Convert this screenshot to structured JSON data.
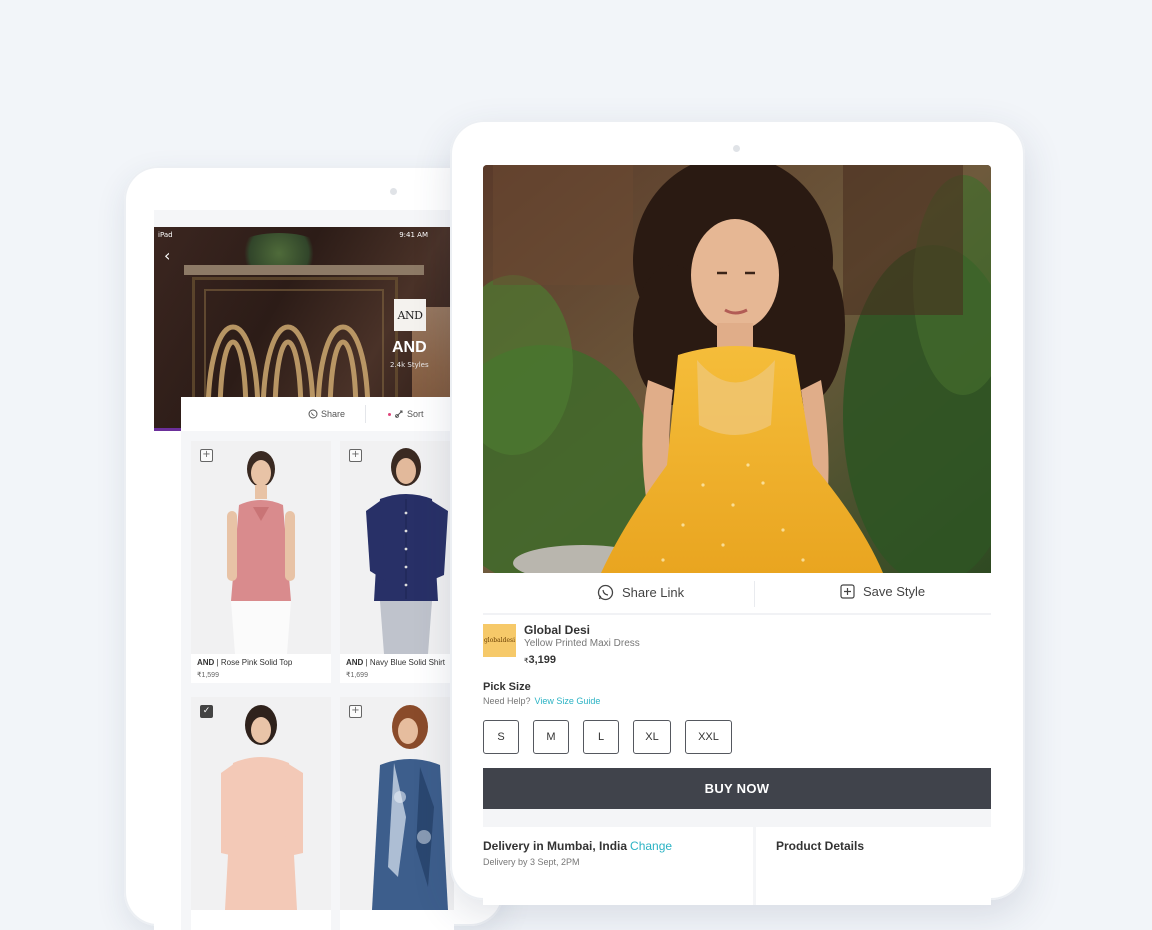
{
  "back_tablet": {
    "status_bar": {
      "device": "iPad",
      "time": "9:41 AM"
    },
    "brand": {
      "logo_text": "AND",
      "name": "AND",
      "styles_count": "2.4k Styles"
    },
    "toolbar": {
      "share_label": "Share",
      "sort_label": "Sort"
    },
    "products": [
      {
        "brand": "AND",
        "name": "Rose Pink Solid Top",
        "price": "₹1,599",
        "selected": false
      },
      {
        "brand": "AND",
        "name": "Navy Blue Solid Shirt",
        "price": "₹1,699",
        "selected": false
      },
      {
        "brand": "",
        "name": "",
        "price": "",
        "selected": true
      },
      {
        "brand": "",
        "name": "",
        "price": "",
        "selected": false
      }
    ]
  },
  "front_tablet": {
    "actions": {
      "share_label": "Share Link",
      "save_label": "Save Style"
    },
    "seller": {
      "logo_text": "globaldesi",
      "name": "Global Desi"
    },
    "product": {
      "name": "Yellow Printed Maxi Dress",
      "currency": "₹",
      "price": "3,199"
    },
    "size": {
      "heading": "Pick Size",
      "help_text": "Need Help?",
      "guide_link": "View Size Guide",
      "options": [
        "S",
        "M",
        "L",
        "XL",
        "XXL"
      ]
    },
    "buy_label": "BUY NOW",
    "delivery": {
      "title": "Delivery in Mumbai, India",
      "change_label": "Change",
      "subtitle": "Delivery by 3 Sept, 2PM"
    },
    "details_title": "Product Details"
  },
  "colors": {
    "background": "#f2f5f9",
    "buy_button": "#40434b",
    "link": "#2bb3c4",
    "seller_logo": "#f6c969",
    "dress_yellow": "#f2b233"
  }
}
